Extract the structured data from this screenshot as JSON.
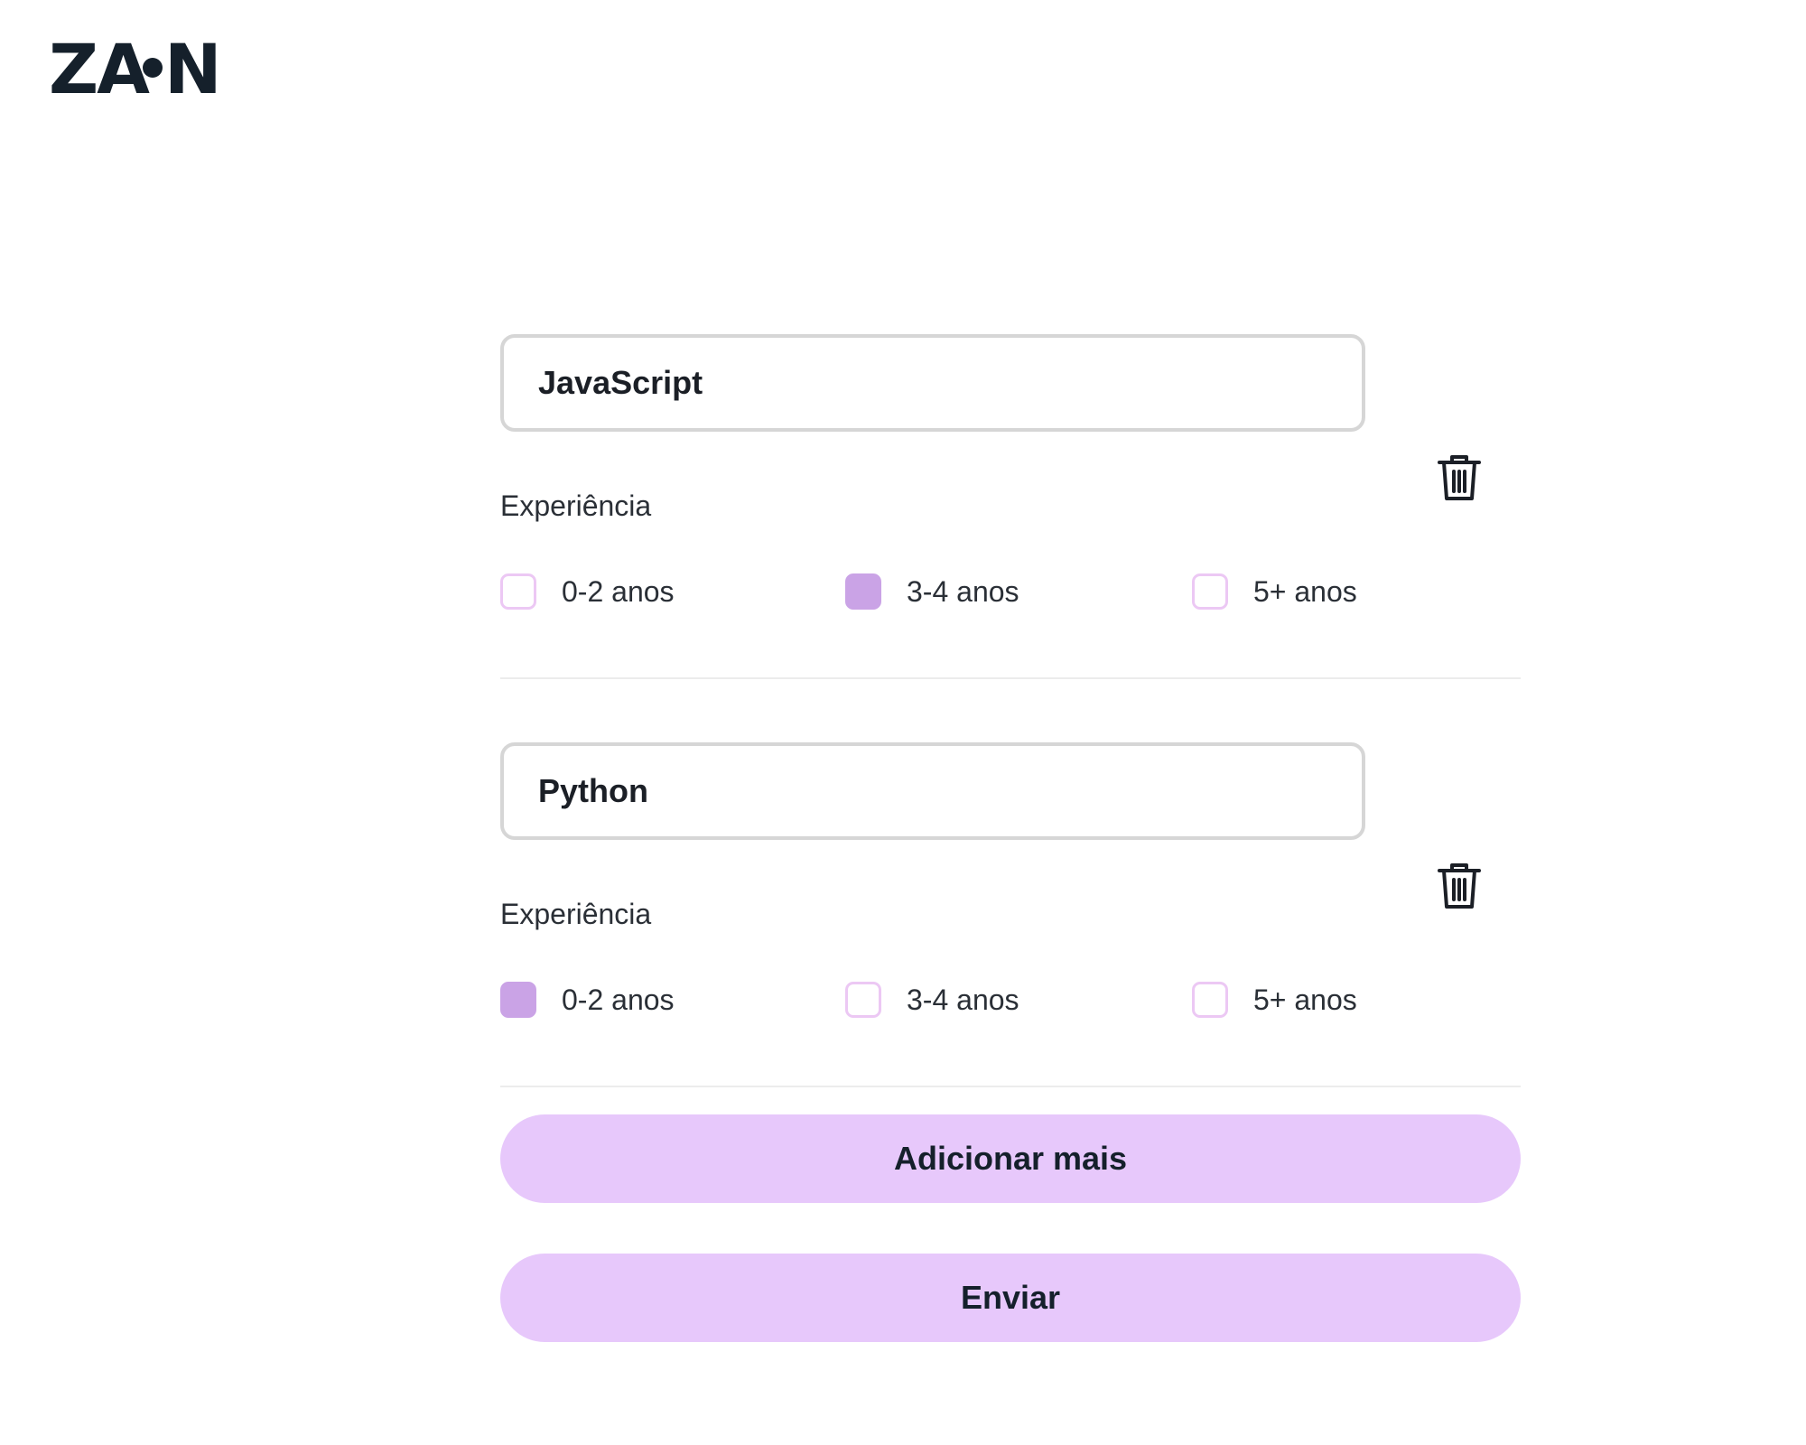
{
  "brand": {
    "logo_left": "ZA",
    "logo_right": "N"
  },
  "skills": [
    {
      "name": "JavaScript",
      "experience_label": "Experiência",
      "options": [
        {
          "label": "0-2 anos",
          "checked": false
        },
        {
          "label": "3-4 anos",
          "checked": true
        },
        {
          "label": "5+ anos",
          "checked": false
        }
      ],
      "delete_icon": "trash-icon"
    },
    {
      "name": "Python",
      "experience_label": "Experiência",
      "options": [
        {
          "label": "0-2 anos",
          "checked": true
        },
        {
          "label": "3-4 anos",
          "checked": false
        },
        {
          "label": "5+ anos",
          "checked": false
        }
      ],
      "delete_icon": "trash-icon"
    }
  ],
  "actions": {
    "add_more_label": "Adicionar mais",
    "submit_label": "Enviar"
  },
  "colors": {
    "accent_button": "#e7c8fb",
    "checkbox_checked": "#caa3e6",
    "checkbox_border": "#ecc8f4",
    "text_dark": "#15202b"
  }
}
